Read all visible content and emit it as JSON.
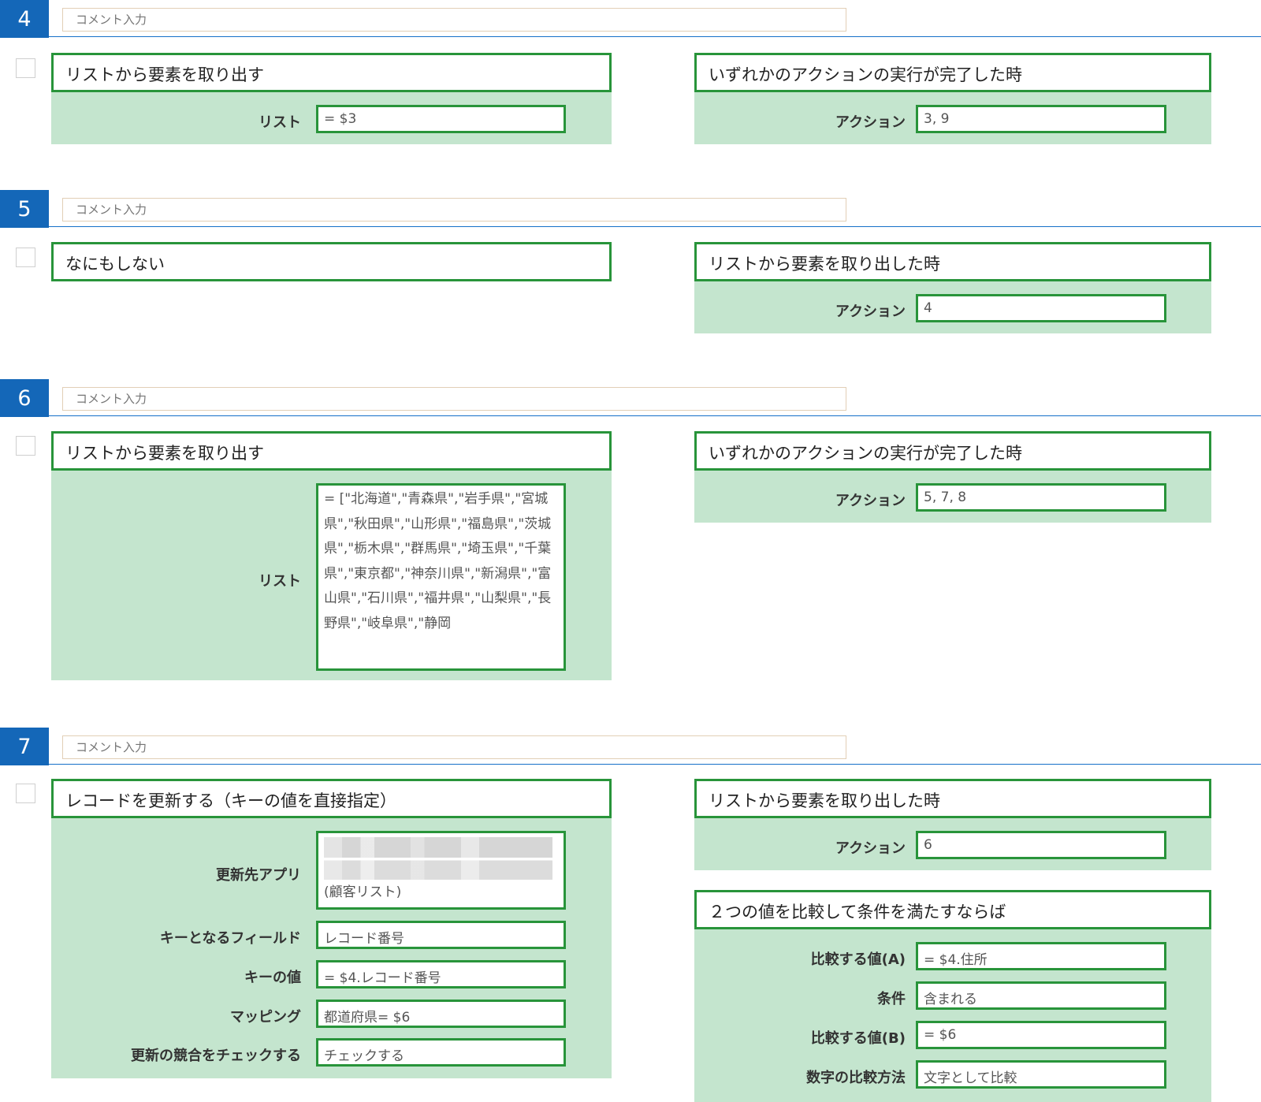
{
  "comment_placeholder": "コメント入力",
  "steps": [
    {
      "number": "4",
      "action": {
        "title": "リストから要素を取り出す",
        "fields": [
          {
            "label": "リスト",
            "value": "= $3"
          }
        ]
      },
      "triggers": [
        {
          "title": "いずれかのアクションの実行が完了した時",
          "fields": [
            {
              "label": "アクション",
              "value": "3, 9"
            }
          ]
        }
      ]
    },
    {
      "number": "5",
      "action": {
        "title": "なにもしない",
        "fields": []
      },
      "triggers": [
        {
          "title": "リストから要素を取り出した時",
          "fields": [
            {
              "label": "アクション",
              "value": "4"
            }
          ]
        }
      ]
    },
    {
      "number": "6",
      "action": {
        "title": "リストから要素を取り出す",
        "fields": [
          {
            "label": "リスト",
            "value": "= [\"北海道\",\"青森県\",\"岩手県\",\"宮城県\",\"秋田県\",\"山形県\",\"福島県\",\"茨城県\",\"栃木県\",\"群馬県\",\"埼玉県\",\"千葉県\",\"東京都\",\"神奈川県\",\"新潟県\",\"富山県\",\"石川県\",\"福井県\",\"山梨県\",\"長野県\",\"岐阜県\",\"静岡"
          }
        ]
      },
      "triggers": [
        {
          "title": "いずれかのアクションの実行が完了した時",
          "fields": [
            {
              "label": "アクション",
              "value": "5, 7, 8"
            }
          ]
        }
      ]
    },
    {
      "number": "7",
      "action": {
        "title": "レコードを更新する（キーの値を直接指定）",
        "fields": [
          {
            "label": "更新先アプリ",
            "value": "(顧客リスト)"
          },
          {
            "label": "キーとなるフィールド",
            "value": "レコード番号"
          },
          {
            "label": "キーの値",
            "value": "= $4.レコード番号"
          },
          {
            "label": "マッピング",
            "value": "都道府県= $6"
          },
          {
            "label": "更新の競合をチェックする",
            "value": "チェックする"
          }
        ]
      },
      "triggers": [
        {
          "title": "リストから要素を取り出した時",
          "fields": [
            {
              "label": "アクション",
              "value": "6"
            }
          ]
        },
        {
          "title": "２つの値を比較して条件を満たすならば",
          "fields": [
            {
              "label": "比較する値(A)",
              "value": "= $4.住所"
            },
            {
              "label": "条件",
              "value": "含まれる"
            },
            {
              "label": "比較する値(B)",
              "value": "= $6"
            },
            {
              "label": "数字の比較方法",
              "value": "文字として比較"
            }
          ]
        }
      ]
    }
  ]
}
